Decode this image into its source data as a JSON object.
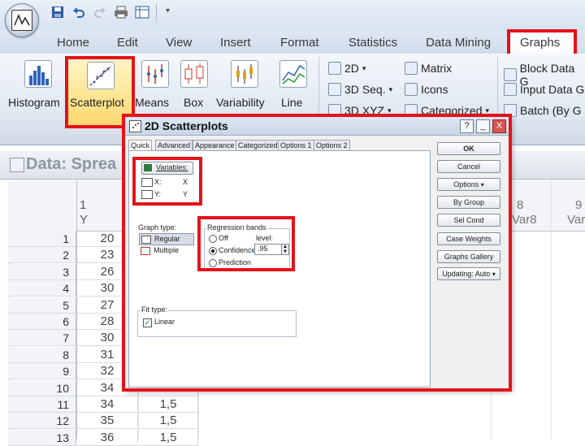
{
  "top_tabs": [
    "Home",
    "Edit",
    "View",
    "Insert",
    "Format",
    "Statistics",
    "Data Mining",
    "Graphs"
  ],
  "ribbon": {
    "big_buttons": [
      "Histogram",
      "Scatterplot",
      "Means",
      "Box",
      "Variability",
      "Line"
    ],
    "col1": [
      "2D",
      "3D Seq.",
      "3D XYZ"
    ],
    "col2": [
      "Matrix",
      "Icons",
      "Categorized"
    ],
    "col3": [
      "Block Data G",
      "Input Data G",
      "Batch (By G"
    ]
  },
  "sheet": {
    "title": "Data: Sprea",
    "col1_num": "1",
    "col1_name": "Y",
    "col8_num": "8",
    "col8_name": "Var8",
    "col9_num": "9",
    "col9_name": "Var",
    "rows": [
      {
        "n": "1",
        "y": "20",
        "x": ""
      },
      {
        "n": "2",
        "y": "23",
        "x": ""
      },
      {
        "n": "3",
        "y": "26",
        "x": ""
      },
      {
        "n": "4",
        "y": "30",
        "x": ""
      },
      {
        "n": "5",
        "y": "27",
        "x": ""
      },
      {
        "n": "6",
        "y": "28",
        "x": ""
      },
      {
        "n": "7",
        "y": "30",
        "x": ""
      },
      {
        "n": "8",
        "y": "31",
        "x": ""
      },
      {
        "n": "9",
        "y": "32",
        "x": ""
      },
      {
        "n": "10",
        "y": "34",
        "x": ""
      },
      {
        "n": "11",
        "y": "34",
        "x": "1,5"
      },
      {
        "n": "12",
        "y": "35",
        "x": "1,5"
      },
      {
        "n": "13",
        "y": "36",
        "x": "1,5"
      }
    ]
  },
  "dialog": {
    "title": "2D Scatterplots",
    "help": "?",
    "minimize": "_",
    "close": "X",
    "tabs": [
      "Quick",
      "Advanced",
      "Appearance",
      "Categorized",
      "Options 1",
      "Options 2"
    ],
    "variables_btn": "Variables:",
    "var_x_label": "X:",
    "var_y_label": "Y:",
    "var_x_value": "X",
    "var_y_value": "Y",
    "graph_type_label": "Graph type:",
    "graph_types": [
      "Regular",
      "Multiple"
    ],
    "regression_label": "Regression bands",
    "band_options": [
      "Off",
      "Confidence",
      "Prediction"
    ],
    "level_label": "level:",
    "level_value": ".95",
    "fit_label": "Fit type:",
    "fit_value": "Linear",
    "side_buttons": [
      "OK",
      "Cancel",
      "Options",
      "By Group",
      "Sel Cond",
      "Case Weights",
      "Graphs Gallery",
      "Updating: Auto"
    ]
  }
}
